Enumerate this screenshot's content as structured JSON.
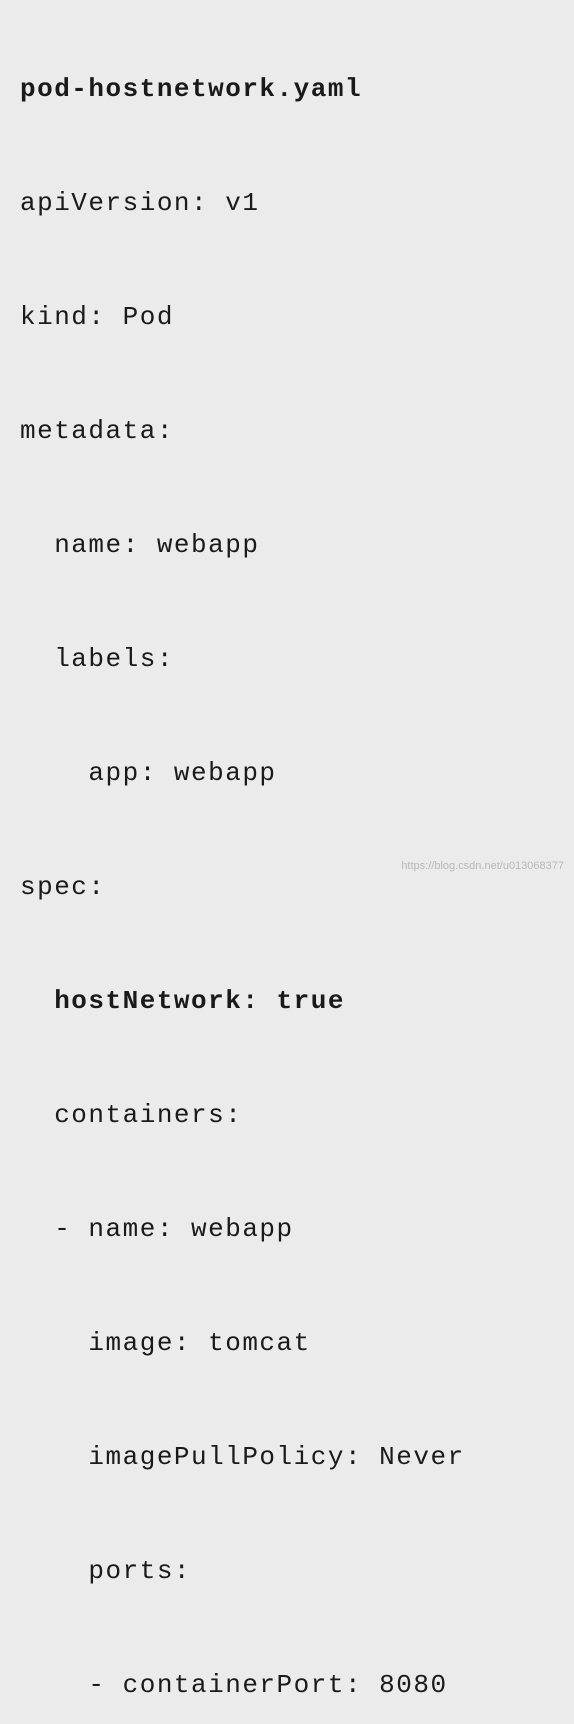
{
  "title": "pod-hostnetwork.yaml",
  "lines": {
    "apiVersion": "apiVersion: v1",
    "kind": "kind: Pod",
    "metadata": "metadata:",
    "metaName": "  name: webapp",
    "labels": "  labels:",
    "labelApp": "    app: webapp",
    "spec": "spec:",
    "hostNetwork": "  hostNetwork: true",
    "containers": "  containers:",
    "containerName": "  - name: webapp",
    "image": "    image: tomcat",
    "imagePullPolicy": "    imagePullPolicy: Never",
    "ports": "    ports:",
    "containerPort": "    - containerPort: 8080"
  },
  "watermark": "https://blog.csdn.net/u013068377"
}
